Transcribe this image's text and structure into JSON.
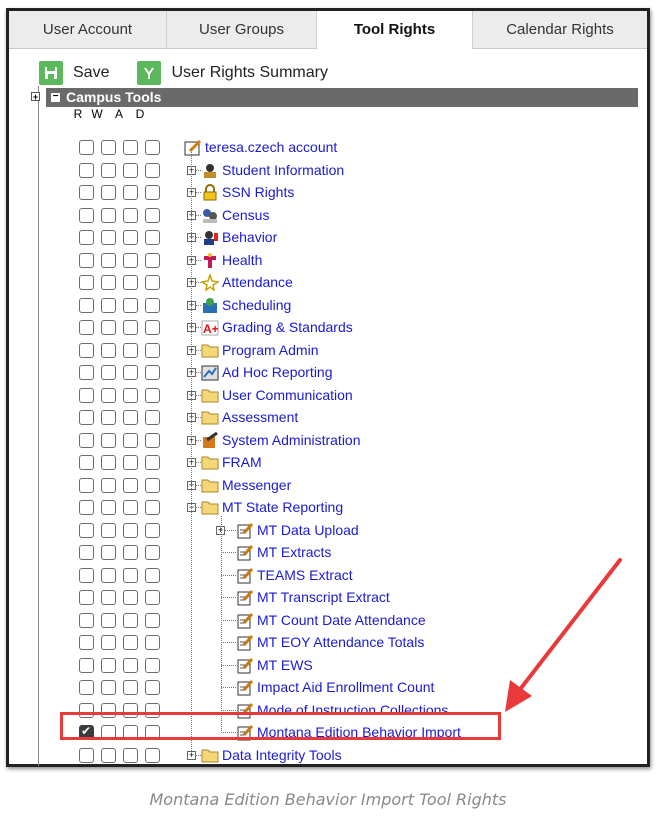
{
  "tabs": [
    "User Account",
    "User Groups",
    "Tool Rights",
    "Calendar Rights"
  ],
  "active_tab": "Tool Rights",
  "toolbar": {
    "save_label": "Save",
    "summary_label": "User Rights Summary"
  },
  "panel": {
    "title": "Campus Tools",
    "columns": [
      "R",
      "W",
      "A",
      "D"
    ]
  },
  "tree": {
    "root": {
      "label": "teresa.czech account",
      "icon": "user-account-icon"
    },
    "items": [
      {
        "label": "Student Information",
        "icon": "student-information-icon",
        "expanded": false
      },
      {
        "label": "SSN Rights",
        "icon": "lock-icon",
        "expanded": false
      },
      {
        "label": "Census",
        "icon": "census-icon",
        "expanded": false
      },
      {
        "label": "Behavior",
        "icon": "behavior-icon",
        "expanded": false
      },
      {
        "label": "Health",
        "icon": "health-icon",
        "expanded": false
      },
      {
        "label": "Attendance",
        "icon": "attendance-icon",
        "expanded": false
      },
      {
        "label": "Scheduling",
        "icon": "scheduling-icon",
        "expanded": false
      },
      {
        "label": "Grading & Standards",
        "icon": "grading-icon",
        "expanded": false
      },
      {
        "label": "Program Admin",
        "icon": "folder-icon",
        "expanded": false
      },
      {
        "label": "Ad Hoc Reporting",
        "icon": "reporting-icon",
        "expanded": false
      },
      {
        "label": "User Communication",
        "icon": "folder-icon",
        "expanded": false
      },
      {
        "label": "Assessment",
        "icon": "folder-icon",
        "expanded": false
      },
      {
        "label": "System Administration",
        "icon": "system-admin-icon",
        "expanded": false
      },
      {
        "label": "FRAM",
        "icon": "folder-icon",
        "expanded": false
      },
      {
        "label": "Messenger",
        "icon": "folder-icon",
        "expanded": false
      },
      {
        "label": "MT State Reporting",
        "icon": "folder-icon",
        "expanded": true
      }
    ],
    "children": [
      {
        "label": "MT Data Upload",
        "icon": "tool-icon",
        "expandable": true,
        "checked": false
      },
      {
        "label": "MT Extracts",
        "icon": "tool-icon",
        "expandable": false,
        "checked": false
      },
      {
        "label": "TEAMS Extract",
        "icon": "tool-icon",
        "expandable": false,
        "checked": false
      },
      {
        "label": "MT Transcript Extract",
        "icon": "tool-icon",
        "expandable": false,
        "checked": false
      },
      {
        "label": "MT Count Date Attendance",
        "icon": "tool-icon",
        "expandable": false,
        "checked": false
      },
      {
        "label": "MT EOY Attendance Totals",
        "icon": "tool-icon",
        "expandable": false,
        "checked": false
      },
      {
        "label": "MT EWS",
        "icon": "tool-icon",
        "expandable": false,
        "checked": false
      },
      {
        "label": "Impact Aid Enrollment Count",
        "icon": "tool-icon",
        "expandable": false,
        "checked": false
      },
      {
        "label": "Mode of Instruction Collections",
        "icon": "tool-icon",
        "expandable": false,
        "checked": false
      },
      {
        "label": "Montana Edition Behavior Import",
        "icon": "tool-icon",
        "expandable": false,
        "checked": true
      }
    ],
    "after": {
      "label": "Data Integrity Tools",
      "icon": "folder-icon",
      "expanded": false
    }
  },
  "caption": "Montana Edition Behavior Import Tool Rights",
  "colors": {
    "link": "#1a1ad4",
    "header": "#6a6a6a",
    "button": "#5cb85c",
    "highlight": "#e8393b",
    "folder": "#f5d77a"
  }
}
